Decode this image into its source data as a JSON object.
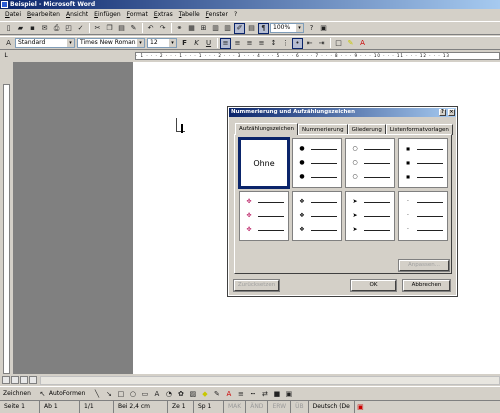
{
  "window": {
    "title": "Beispiel - Microsoft Word"
  },
  "menu": [
    "Datei",
    "Bearbeiten",
    "Ansicht",
    "Einfügen",
    "Format",
    "Extras",
    "Tabelle",
    "Fenster",
    "?"
  ],
  "toolbar": {
    "zoom": "100%"
  },
  "format": {
    "style": "Standard",
    "font": "Times New Roman",
    "size": "12"
  },
  "ruler_text": "· 1 · · · 2 · · · 1 · · · 1 · · · 2 · · · 3 · · · 4 · · · 5 · · · 6 · · · 7 · · · 8 · · · 9 · · · 10 · · · 11 · · · 12 · · · 13",
  "dialog": {
    "title": "Nummerierung und Aufzählungszeichen",
    "help": "?",
    "close": "×",
    "tabs": [
      "Aufzählungszeichen",
      "Nummerierung",
      "Gliederung",
      "Listenformatvorlagen"
    ],
    "none_label": "Ohne",
    "customize": "Anpassen...",
    "reset": "Zurücksetzen",
    "ok": "OK",
    "cancel": "Abbrechen"
  },
  "drawbar": {
    "draw": "Zeichnen",
    "autoshapes": "AutoFormen"
  },
  "status": {
    "page": "Seite  1",
    "section": "Ab  1",
    "pages": "1/1",
    "at": "Bei 2,4 cm",
    "line": "Ze  1",
    "col": "Sp  1",
    "mak": "MAK",
    "and": "ÄND",
    "erw": "ERW",
    "ub": "ÜB",
    "lang": "Deutsch (De"
  }
}
